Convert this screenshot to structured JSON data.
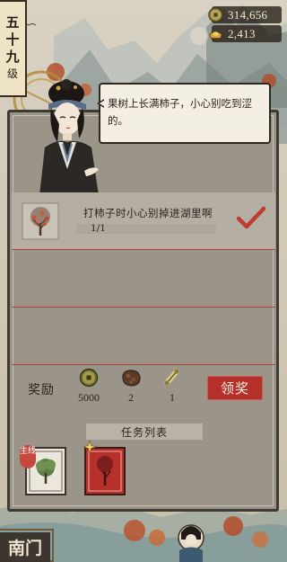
{
  "player": {
    "level_chars": [
      "五",
      "十",
      "九",
      "级"
    ]
  },
  "currency": {
    "coins": "314,656",
    "gems": "2,413"
  },
  "npc": {
    "dialogue": "果树上长满柿子，小心别吃到涩的。"
  },
  "tasks": [
    {
      "name": "打柿子时小心别掉进湖里啊",
      "progress_text": "1/1",
      "progress_fraction": 1.0,
      "completed": true,
      "icon": "persimmon-tree-icon"
    }
  ],
  "rewards": {
    "label": "奖励",
    "items": [
      {
        "icon": "coin-icon",
        "amount": "5000"
      },
      {
        "icon": "ore-icon",
        "amount": "2"
      },
      {
        "icon": "scroll-icon",
        "amount": "1"
      }
    ],
    "claim_label": "领奖"
  },
  "task_list": {
    "header": "任务列表",
    "cards": [
      {
        "icon": "tree-card-icon",
        "tag": "主线"
      },
      {
        "icon": "red-tree-card-icon",
        "tag": ""
      }
    ]
  },
  "location": {
    "name": "南门"
  },
  "colors": {
    "accent_red": "#b4302b",
    "panel_gray": "#9b9489",
    "badge_cream": "#efe3c6"
  }
}
